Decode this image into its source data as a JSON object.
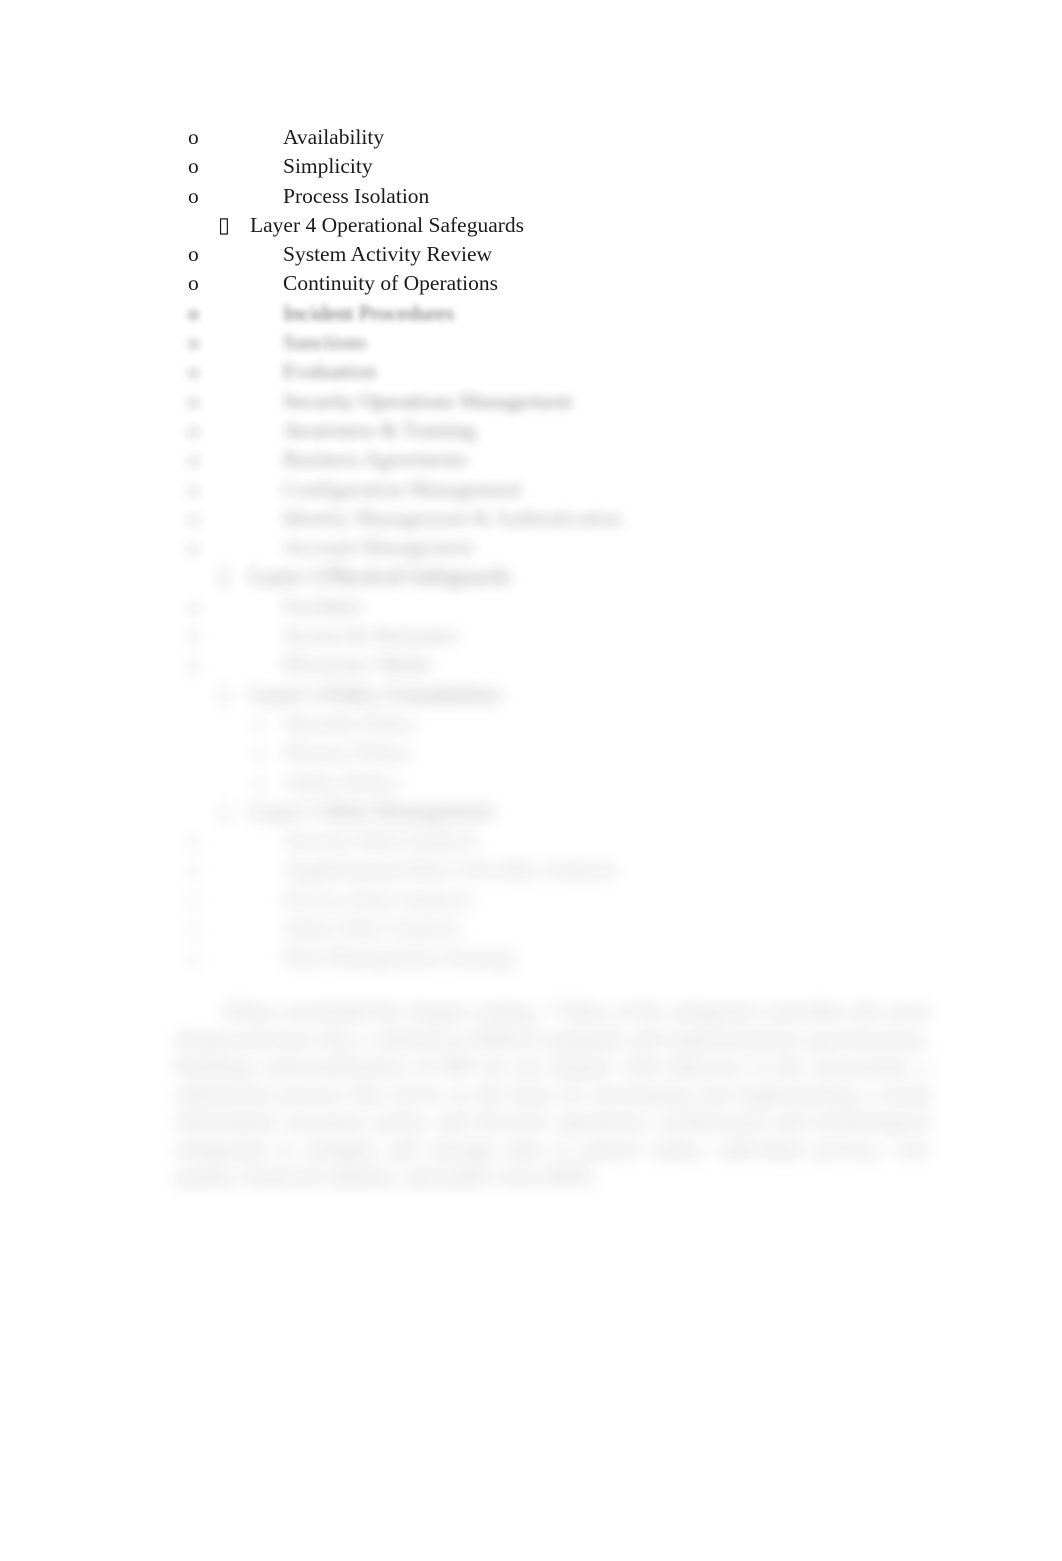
{
  "document": {
    "type": "word-processor-outline",
    "background_color": "#ffffff",
    "text_color": "#1a1a1a",
    "bullet_marker_o": "o",
    "bullet_marker_box": "▯"
  },
  "outline": {
    "items": [
      {
        "level": "o",
        "text": "Availability",
        "bold": false,
        "blur": 0
      },
      {
        "level": "o",
        "text": "Simplicity",
        "bold": false,
        "blur": 0
      },
      {
        "level": "o",
        "text": "Process Isolation",
        "bold": false,
        "blur": 0
      },
      {
        "level": "box",
        "text": "Layer 4 Operational Safeguards",
        "bold": false,
        "blur": 0
      },
      {
        "level": "o",
        "text": "System Activity Review",
        "bold": false,
        "blur": 0
      },
      {
        "level": "o",
        "text": "Continuity of Operations",
        "bold": false,
        "blur": 0
      },
      {
        "level": "o",
        "text": "Incident Procedures",
        "bold": false,
        "blur": 4
      },
      {
        "level": "o",
        "text": "Sanctions",
        "bold": false,
        "blur": 6
      },
      {
        "level": "o",
        "text": "Evaluation",
        "bold": false,
        "blur": 7
      },
      {
        "level": "o",
        "text": "Security Operations Management",
        "bold": false,
        "blur": 8
      },
      {
        "level": "o",
        "text": "Awareness & Training",
        "bold": false,
        "blur": 9
      },
      {
        "level": "o",
        "text": "Business Agreements",
        "bold": false,
        "blur": 10
      },
      {
        "level": "o",
        "text": "Configuration Management",
        "bold": false,
        "blur": 11
      },
      {
        "level": "o",
        "text": "Identity Management & Authentication",
        "bold": false,
        "blur": 12
      },
      {
        "level": "o",
        "text": "Account Management",
        "bold": false,
        "blur": 13
      },
      {
        "level": "box",
        "text": "Layer 3 Physical Safeguards",
        "bold": true,
        "blur": 14
      },
      {
        "level": "o",
        "text": "Facilities",
        "bold": false,
        "blur": 15
      },
      {
        "level": "o",
        "text": "Access & Structures",
        "bold": false,
        "blur": 16
      },
      {
        "level": "o",
        "text": "Electronic Media",
        "bold": false,
        "blur": 17
      },
      {
        "level": "box",
        "text": "Layer 2 Policy Foundations",
        "bold": true,
        "blur": 18
      },
      {
        "level": "deep",
        "text": "Security Policy",
        "bold": false,
        "blur": 19
      },
      {
        "level": "deep",
        "text": "Privacy Policy",
        "bold": false,
        "blur": 19
      },
      {
        "level": "deep",
        "text": "Safety Policy",
        "bold": false,
        "blur": 20
      },
      {
        "level": "box",
        "text": "Layer 1 Risk Management",
        "bold": true,
        "blur": 20
      },
      {
        "level": "o",
        "text": "Security Risk Analysis",
        "bold": false,
        "blur": 21
      },
      {
        "level": "o",
        "text": "Supplemental Risk Criticality Analysis",
        "bold": false,
        "blur": 21
      },
      {
        "level": "o",
        "text": "Privacy Risk Analysis",
        "bold": false,
        "blur": 22
      },
      {
        "level": "o",
        "text": "Safety Risk Analysis",
        "bold": false,
        "blur": 22
      },
      {
        "level": "o",
        "text": "Risk Management Strategy",
        "bold": false,
        "blur": 22
      }
    ]
  },
  "paragraph": {
    "text": "When concluded the chapter setting, 7 Titles of the safeguard controllers the most framework have they a defined to HIPAA standards and implementation specifications. Building contextualization of HIP set out chapter with objective to the assessment, a submission process that serves as the basis for developing and implementing a sound information assurance policy and decision operations, architectural and technological safeguards to mitigate and manage data to patient safety, individual privacy, care quality, financial stability, and public trust (HIP)."
  }
}
